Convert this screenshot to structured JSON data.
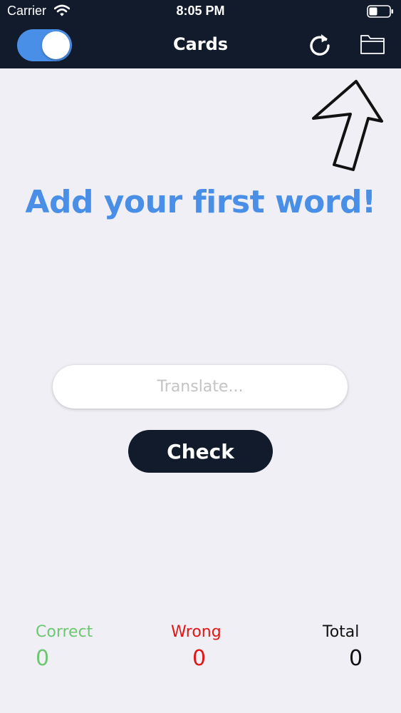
{
  "status_bar": {
    "carrier": "Carrier",
    "time": "8:05 PM"
  },
  "nav": {
    "title": "Cards",
    "toggle_on": true,
    "icons": [
      "refresh-icon",
      "folder-icon"
    ]
  },
  "main": {
    "headline": "Add your first word!",
    "translate_placeholder": "Translate...",
    "check_label": "Check"
  },
  "stats": {
    "correct_label": "Correct",
    "correct_value": "0",
    "wrong_label": "Wrong",
    "wrong_value": "0",
    "total_label": "Total",
    "total_value": "0"
  },
  "colors": {
    "header_bg": "#111b2b",
    "accent_blue": "#4a8fe7",
    "correct_green": "#6cc870",
    "wrong_red": "#e01717",
    "background": "#f0eff5"
  }
}
